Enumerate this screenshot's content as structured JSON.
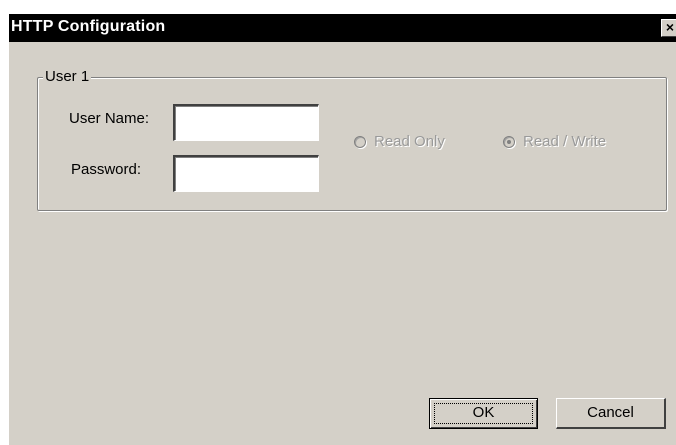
{
  "window": {
    "title": "HTTP Configuration",
    "close_glyph": "✕"
  },
  "group": {
    "label": "User 1"
  },
  "fields": {
    "username_label": "User Name:",
    "username_value": "",
    "password_label": "Password:",
    "password_value": ""
  },
  "access": {
    "read_only_label": "Read Only",
    "read_only_selected": false,
    "read_write_label": "Read / Write",
    "read_write_selected": true,
    "disabled": true
  },
  "buttons": {
    "ok_label": "OK",
    "cancel_label": "Cancel"
  },
  "colors": {
    "title_bar": "#000000",
    "dialog_face": "#d4d0c8",
    "disabled_text": "#9a9a9a"
  },
  "icons": {
    "close": "close-icon",
    "radio": "radio-button-icon"
  }
}
